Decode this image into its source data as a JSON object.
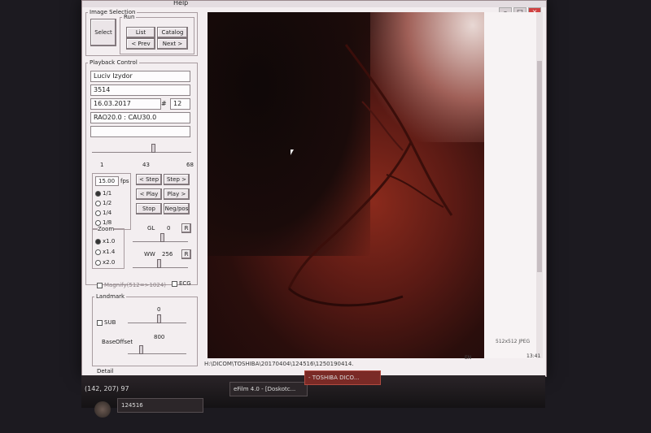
{
  "menu": {
    "partial": "Help"
  },
  "image_selection": {
    "title": "Image Selection",
    "select": "Select",
    "run": {
      "title": "Run",
      "list": "List",
      "catalog": "Catalog",
      "prev": "< Prev",
      "next": "Next >"
    }
  },
  "playback": {
    "title": "Playback Control",
    "patient_name": "Luciv Izydor",
    "patient_id": "3514",
    "date": "16.03.2017",
    "hash": "#",
    "frame_count": "12",
    "angles": "RAO20.0 : CAU30.0",
    "slider_min": "1",
    "slider_cur": "43",
    "slider_max": "68",
    "slider_fraction": 0.62,
    "fps_value": "15.00",
    "fps_unit": "fps",
    "speeds": [
      "1/1",
      "1/2",
      "1/4",
      "1/8"
    ],
    "step_back": "< Step",
    "step_fwd": "Step >",
    "play_back": "< Play",
    "play_fwd": "Play >",
    "stop": "Stop",
    "negpos": "Neg/pos"
  },
  "zoom": {
    "title": "Zoom",
    "options": [
      "x1.0",
      "x1.4",
      "x2.0"
    ]
  },
  "gl": {
    "label": "GL",
    "value": "0",
    "reset": "R"
  },
  "ww": {
    "label": "WW",
    "value": "256",
    "reset": "R"
  },
  "magnify": "Magnify(512=>1024)",
  "ecg": "ECG",
  "landmark": {
    "title": "Landmark",
    "sub": "SUB",
    "sub_value": "0",
    "base_label": "BaseOffset",
    "base_value": "800"
  },
  "detail": "Detail",
  "status": {
    "coords": "(142, 207) 97",
    "path": "H:\\DICOM\\TOSHIBA\\20170404\\124516\\1250190414.",
    "size": "512x512 JPEG",
    "lang": "EN",
    "time": "13:41"
  },
  "taskbar": {
    "items": [
      "124516",
      "eFilm 4.0 - [Doskotc...",
      "- TOSHIBA DICO..."
    ]
  }
}
